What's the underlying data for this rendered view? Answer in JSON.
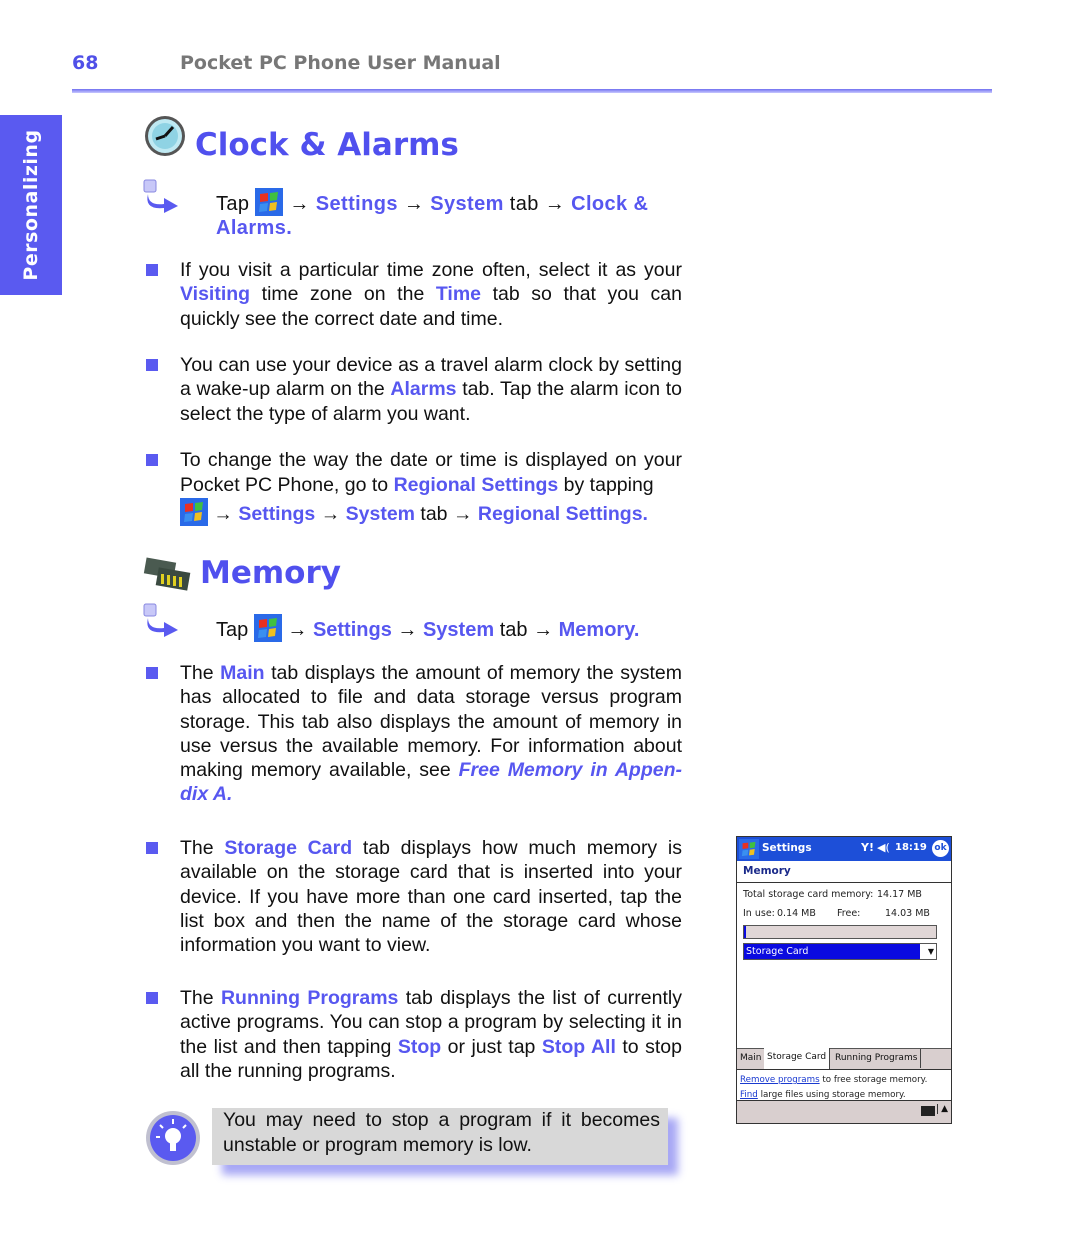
{
  "header": {
    "page_number": "68",
    "title": "Pocket PC Phone User Manual"
  },
  "side_tab": {
    "label": "Personalizing"
  },
  "colors": {
    "accent": "#5a5af0",
    "tip_shadow": "#a8a8f5",
    "device_titlebar": "#1d4fd8"
  },
  "clock_section": {
    "title": "Clock & Alarms",
    "step": {
      "tap": "Tap",
      "arrow": "→",
      "settings": "Settings",
      "system": "System",
      "tab": "tab",
      "target": "Clock & Alarms."
    },
    "bullets": [
      {
        "p1": "If you visit a particular time zone often, select it as your ",
        "h1": "Visiting",
        "p2": " time zone on the ",
        "h2": "Time",
        "p3": " tab so that you can quickly see the correct date and time."
      },
      {
        "p1": "You can use your device as a travel alarm clock by setting a wake-up alarm on the ",
        "h1": "Alarms",
        "p2": " tab. Tap the alarm icon to select the type of alarm you want."
      },
      {
        "p1": "To change the way the date or time is displayed on your Pocket PC Phone, go to ",
        "h1": "Regional Settings",
        "p2": " by tapping",
        "arrow": "→",
        "settings": "Settings",
        "system": "System",
        "tab": "tab",
        "target": "Regional Settings."
      }
    ]
  },
  "memory_section": {
    "title": "Memory",
    "step": {
      "tap": "Tap",
      "arrow": "→",
      "settings": "Settings",
      "system": "System",
      "tab": "tab",
      "target": "Memory."
    },
    "bullets": [
      {
        "p1": "The ",
        "h1": "Main",
        "p2": " tab displays the amount of memory the system has allocated to file and data storage versus program storage. This tab also displays the amount of memory in use versus the available memory. For information about making memory available, see ",
        "h2": "Free Memory in Appen-dix A."
      },
      {
        "p1": "The ",
        "h1": "Storage Card",
        "p2": " tab displays how much memory is available on the storage card that is inserted into your device. If you have more than one card inserted, tap the list box and then the name of the storage card whose information you want to view."
      },
      {
        "p1": "The ",
        "h1": "Running Programs",
        "p2": " tab displays the list of currently active programs. You can stop a program by selecting it in the list and then tapping ",
        "h2": "Stop",
        "p3": " or just tap ",
        "h3": "Stop All",
        "p4": " to stop all the running programs."
      }
    ],
    "tip": "You may need to stop a program if it becomes unstable or program memory is low."
  },
  "device": {
    "app_title": "Settings",
    "time": "18:19",
    "ok_label": "ok",
    "heading": "Memory",
    "total_label": "Total storage card memory:",
    "total_value": "14.17 MB",
    "in_use_label": "In use:",
    "in_use_value": "0.14 MB",
    "free_label": "Free:",
    "free_value": "14.03 MB",
    "usage_fraction": 0.01,
    "selected_card": "Storage Card",
    "tabs": [
      "Main",
      "Storage Card",
      "Running Programs"
    ],
    "active_tab": "Storage Card",
    "link1": "Remove programs",
    "link1_rest": " to free storage memory.",
    "link2": "Find",
    "link2_rest": " large files using storage memory."
  }
}
